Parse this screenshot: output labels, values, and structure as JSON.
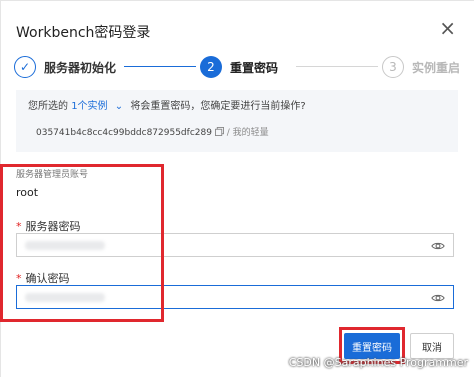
{
  "dialog": {
    "title": "Workbench密码登录",
    "close_symbol": "×"
  },
  "steps": [
    {
      "number": "✓",
      "label": "服务器初始化",
      "state": "done"
    },
    {
      "number": "2",
      "label": "重置密码",
      "state": "active"
    },
    {
      "number": "3",
      "label": "实例重启",
      "state": "pending"
    }
  ],
  "info": {
    "selected_prefix": "您所选的",
    "selected_link": "1个实例",
    "selected_suffix": "将会重置密码，您确定要进行当前操作?",
    "instance_id": "035741b4c8cc4c99bddc872955dfc289",
    "instance_name": "/ 我的轻量"
  },
  "form": {
    "admin_account_label": "服务器管理员账号",
    "admin_account_value": "root",
    "password_label": "服务器密码",
    "confirm_label": "确认密码",
    "required_mark": "*"
  },
  "buttons": {
    "reset": "重置密码",
    "cancel": "取消"
  },
  "watermark": "CSDN @Saraphines Programmer",
  "colors": {
    "accent": "#1a6cd8",
    "highlight_box": "#e0282e",
    "required": "#e02020"
  }
}
